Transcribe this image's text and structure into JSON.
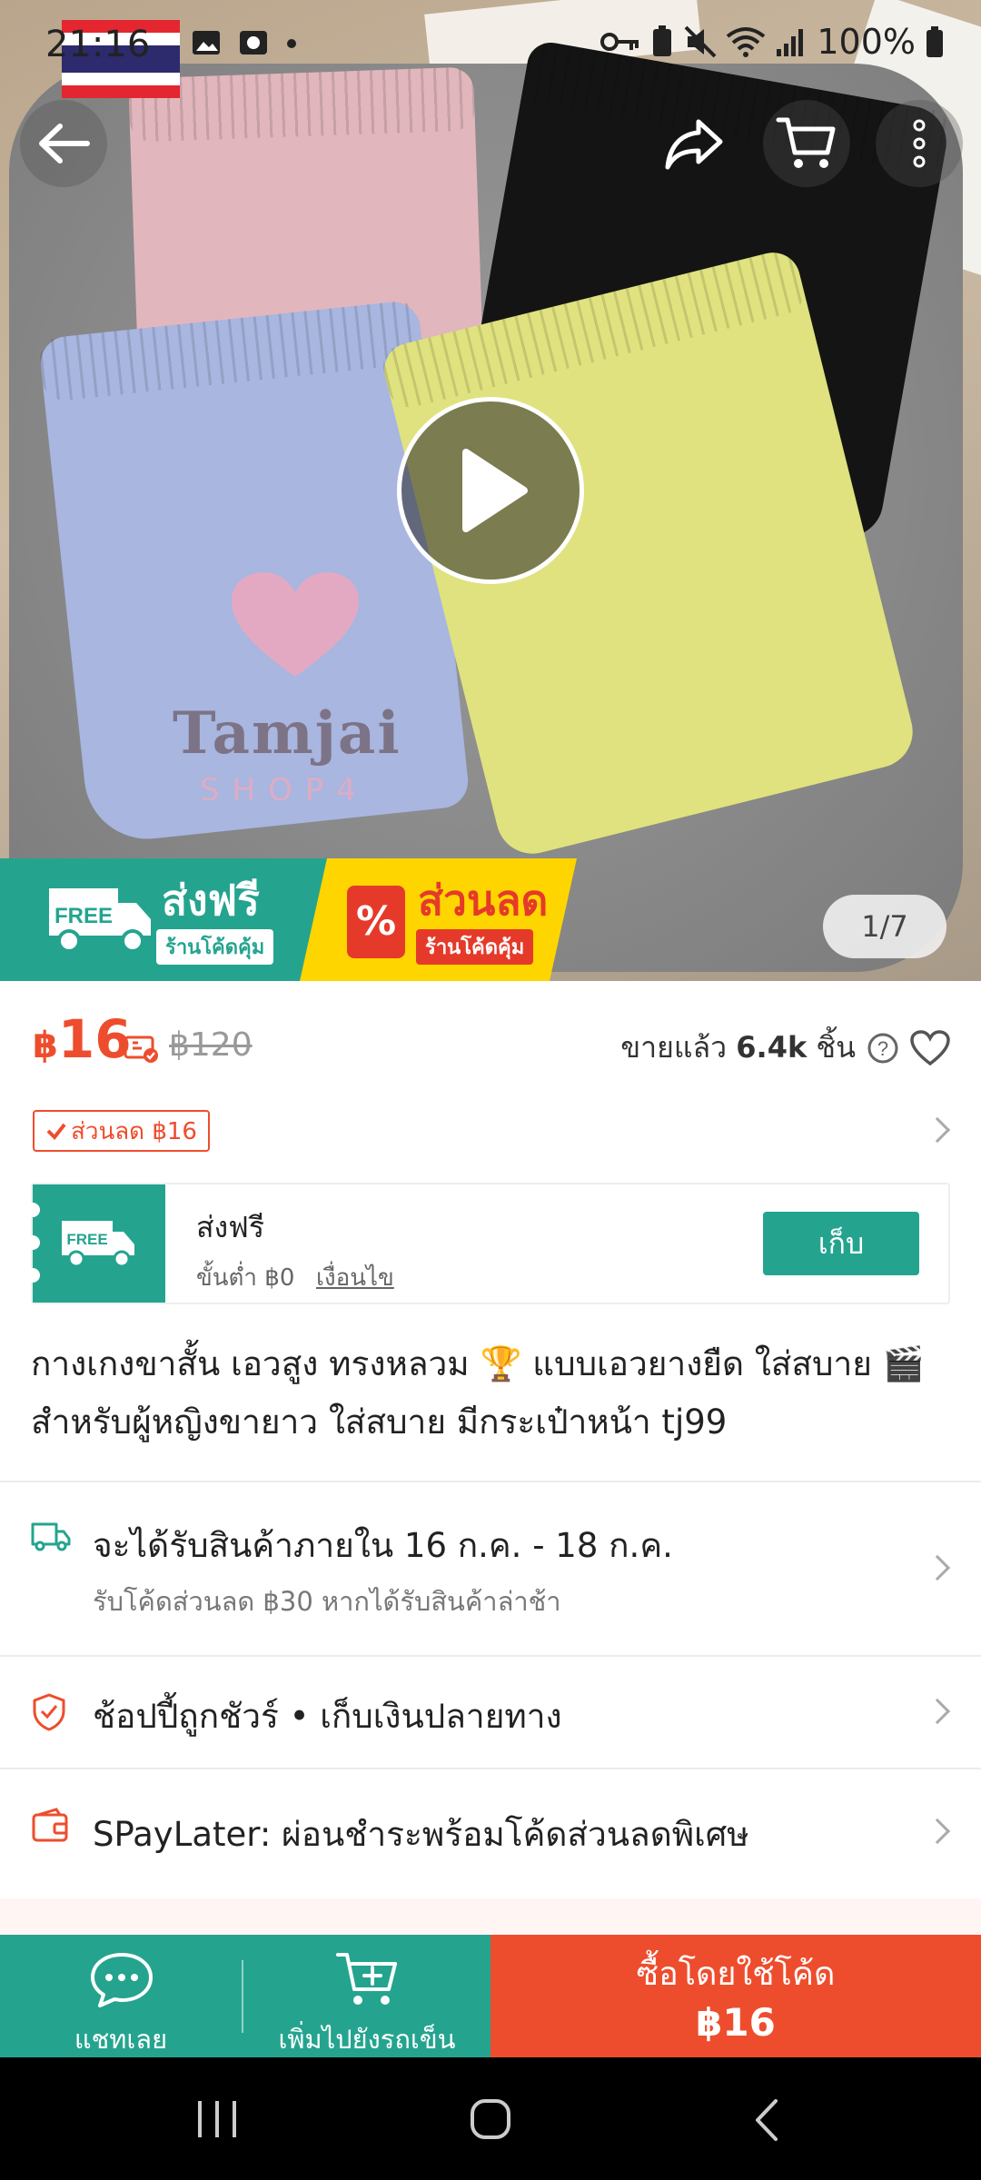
{
  "status_bar": {
    "time": "21:16",
    "battery": "100%"
  },
  "media": {
    "watermark_main": "Tamjai",
    "watermark_sub": "SHOP4",
    "counter": "1/7",
    "banner": {
      "free_badge": "FREE",
      "free_title": "ส่งฟรี",
      "free_sub": "ร้านโค้ดคุ้ม",
      "sale_title": "ส่วนลด",
      "sale_sub": "ร้านโค้ดคุ้ม",
      "sale_icon": "%"
    }
  },
  "price": {
    "currency": "฿",
    "current": "16",
    "original": "฿120",
    "sold_label": "ขายแล้ว",
    "sold_count": "6.4k",
    "sold_unit": "ชิ้น",
    "help_icon": "?"
  },
  "discount_tag": "ส่วนลด ฿16",
  "voucher": {
    "badge": "FREE",
    "title": "ส่งฟรี",
    "min_spend": "ขั้นต่ำ ฿0",
    "conditions": "เงื่อนไข",
    "collect": "เก็บ"
  },
  "product": {
    "title_line1": "กางเกงขาสั้น เอวสูง ทรงหลวม 🏆 แบบเอวยางยืด ใส่สบาย 🎬",
    "title_line2": "สำหรับผู้หญิงขายาว ใส่สบาย มีกระเป๋าหน้า tj99"
  },
  "shipping": {
    "main": "จะได้รับสินค้าภายใน 16 ก.ค. - 18 ก.ค.",
    "sub": "รับโค้ดส่วนลด ฿30 หากได้รับสินค้าล่าช้า"
  },
  "guarantee": "ช้อปปี้ถูกชัวร์ • เก็บเงินปลายทาง",
  "paylater": "SPayLater: ผ่อนชำระพร้อมโค้ดส่วนลดพิเศษ",
  "actions": {
    "chat": "แชทเลย",
    "add_to_cart": "เพิ่มไปยังรถเข็น",
    "buy_line1": "ซื้อโดยใช้โค้ด",
    "buy_line2": "฿16"
  },
  "colors": {
    "accent_orange": "#ee4d2d",
    "teal": "#24a48f",
    "banner_yellow": "#ffd500"
  }
}
